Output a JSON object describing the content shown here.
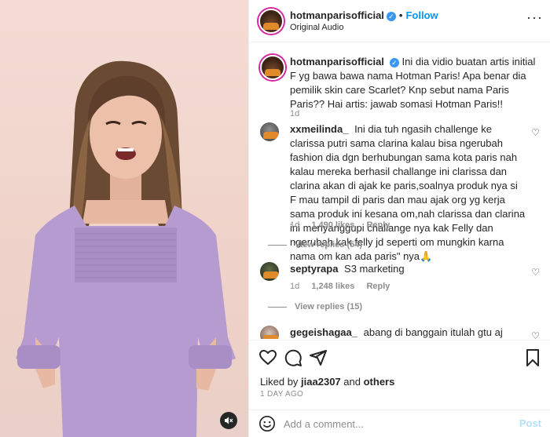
{
  "header": {
    "username": "hotmanparisofficial",
    "follow_label": "Follow",
    "subtitle": "Original Audio",
    "more_label": "···"
  },
  "caption": {
    "username": "hotmanparisofficial",
    "text": "Ini dia vidio buatan artis initial F yg bawa bawa nama Hotman Paris! Apa benar dia pemilik skin care Scarlet? Knp sebut nama Paris Paris?? Hai artis: jawab somasi Hotman Paris!!",
    "age": "1d"
  },
  "comments": [
    {
      "username": "xxmeilinda_",
      "text": "Ini dia tuh ngasih challenge ke clarissa putri sama clarina kalau bisa ngerubah fashion dia dgn berhubungan sama kota paris nah kalau mereka berhasil challange ini clarissa dan clarina akan di ajak ke paris,soalnya produk nya si F mau tampil di paris dan mau ajak org yg kerja sama produk ini kesana om,nah clarissa dan clarina ini menyanggupi challange nya kak Felly dan ngerubah kak felly jd seperti om mungkin karna nama om kan ada paris\" nya🙏",
      "age": "1d",
      "likes": "1,490 likes",
      "reply_label": "Reply",
      "view_replies": "View replies (54)"
    },
    {
      "username": "septyrapa",
      "text": "S3 marketing",
      "age": "1d",
      "likes": "1,248 likes",
      "reply_label": "Reply",
      "view_replies": "View replies (15)"
    },
    {
      "username": "gegeishagaa_",
      "text": "abang di banggain itulah gtu aj yaelah trand"
    }
  ],
  "actions": {
    "liked_prefix": "Liked by",
    "liked_user": "jiaa2307",
    "liked_and": "and",
    "liked_others": "others",
    "age": "1 DAY AGO"
  },
  "composer": {
    "placeholder": "Add a comment...",
    "post_label": "Post"
  },
  "icons": {
    "verified": "verified-badge-icon",
    "heart": "heart-icon",
    "comment": "comment-icon",
    "share": "share-icon",
    "save": "bookmark-icon",
    "emoji": "emoji-icon",
    "mute": "muted-speaker-icon"
  },
  "colors": {
    "accent": "#0095f6",
    "verified": "#3897f0",
    "muted_text": "#8e8e8e",
    "dress": "#b59bd0",
    "wall": "#f1d7cf"
  }
}
